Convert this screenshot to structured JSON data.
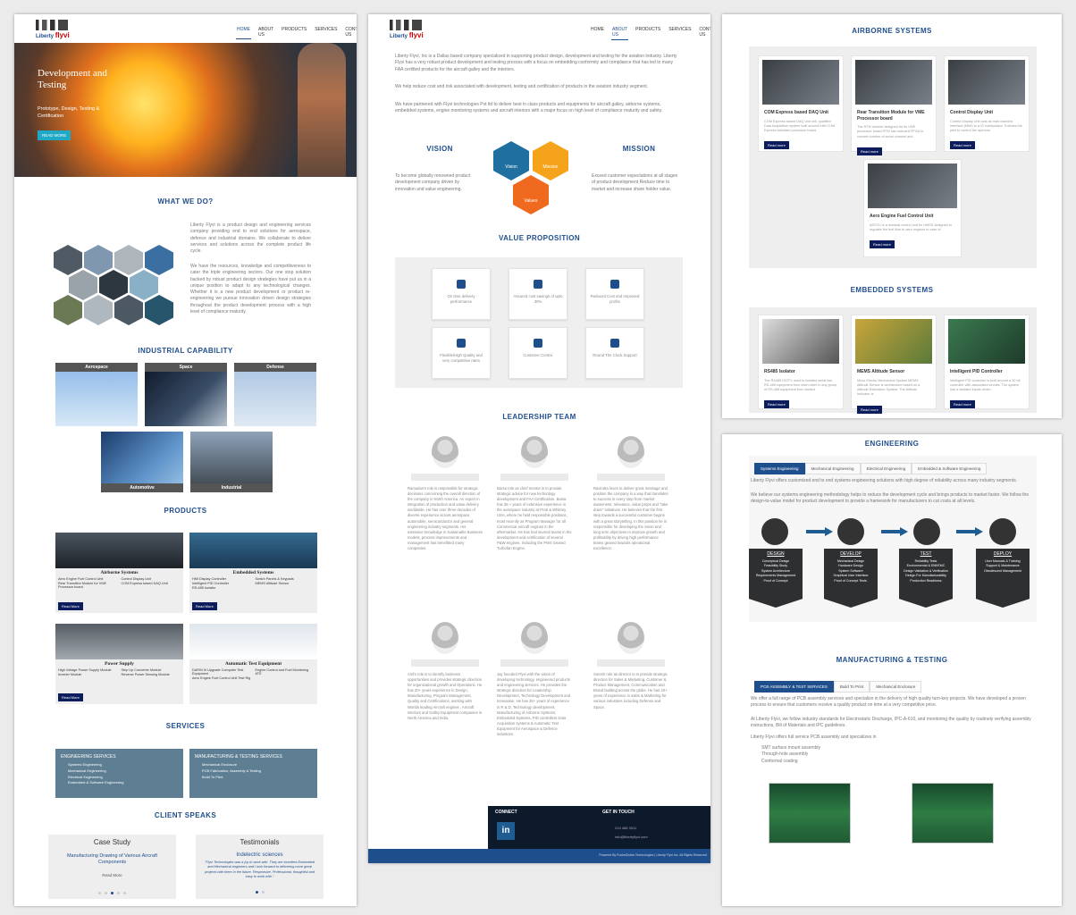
{
  "nav": {
    "home": "HOME",
    "about": "ABOUT US",
    "products": "PRODUCTS",
    "services": "SERVICES",
    "contact": "CONTACT US"
  },
  "logo": {
    "a": "Liberty",
    "b": "flyvi"
  },
  "p1": {
    "hero_title": "Development and Testing",
    "hero_sub": "Prototype, Design, Testing & Certification",
    "hero_btn": "READ MORE",
    "what_title": "WHAT WE DO?",
    "what_p1": "Liberty Flyvi is a product design and engineering services company providing end to end solutions for aerospace, defence and industrial domains. We collaborate to deliver services and solutions across the complete product life cycle.",
    "what_p2": "We have the resources, knowledge and competitiveness to cater the triple engineering sectors. Our one stop solution backed by robust product design strategies have put us in a unique position to adapt to any technological changes. Whether it is a new product development or product re-engineering we pursue innovation driven design strategies throughout the product development process with a high level of compliance maturity.",
    "ind_title": "INDUSTRIAL CAPABILITY",
    "ind": [
      "Aerospace",
      "Space",
      "Defense",
      "Automotive",
      "Industrial"
    ],
    "prod_title": "PRODUCTS",
    "prod_air": "Airborne Systems",
    "prod_air_items": [
      "Aero Engine Fuel Control Unit",
      "Control Display Unit",
      "Rear Transition Module for VME Processor board",
      "COM Express based DAQ Unit"
    ],
    "prod_emb": "Embedded Systems",
    "prod_emb_items": [
      "HMI Display Controller",
      "Switch Panels & Keypads",
      "Intelligent PID Controller",
      "MEMS Altitude Sensor",
      "RS-485 Isolator"
    ],
    "prod_pow": "Power Supply",
    "prod_pow_items": [
      "High Voltage Power Supply Module",
      "Step Up Converter Module",
      "Inverter Module",
      "Reverse Power Sensing Module"
    ],
    "prod_ate": "Automatic Test Equipment",
    "prod_ate_items": [
      "DARIN III Upgrade Computer Test Equipment",
      "Engine Control and Fuel Monitoring ATE",
      "Aero Engine Fuel Control Unit Test Rig"
    ],
    "read_more": "Read More",
    "svc_title": "SERVICES",
    "svc_eng": "ENGINEERING SERVICES",
    "svc_eng_items": [
      "Systems Engineering",
      "Mechanical Engineering",
      "Electrical Engineering",
      "Embedded & Software Engineering"
    ],
    "svc_mfg": "MANUFACTURING & TESTING SERVICES",
    "svc_mfg_items": [
      "Mechanical Enclosure",
      "PCB Fabrication, Assembly & Testing",
      "Build To Print"
    ],
    "client_title": "CLIENT SPEAKS",
    "case_title": "Case Study",
    "case_sub": "Manufacturing Drawing of Various Aircraft Components",
    "case_btn": "Read More",
    "test_title": "Testimonials",
    "test_sub": "Indelectric sciences",
    "test_quote": "\"Flyvi Technologies was a joy to work with. They are excellent Embedded and Mechanical engineers and I look forward to delivering more great projects with them in the future. Responsive, Professional, thoughtful and easy to work with.\""
  },
  "p2": {
    "intro1": "Liberty Flyvi, Inc is a Dallas based company specialized in supporting product design, development and testing for the aviation industry. Liberty Flyvi has a very robust product development and testing process with a focus on embedding conformity and compliance that has led to many FAA certified products for the aircraft galley and the interiors.",
    "intro2": "We help reduce cost and risk associated with development, testing and certification of products in the aviation industry segment.",
    "intro3": "We have partnered with Flyvi technologies Pvt ltd to deliver best in class products and equipments for aircraft galley, airborne systems, embedded systems, engine monitoring systems and aircraft interiors with a major focus on high level of compliance maturity and safety.",
    "vision": "VISION",
    "vision_txt": "To become globally renowned product development company driven by innovation and value engineering.",
    "mission": "MISSION",
    "mission_txt": "Exceed customer expectations at all stages of product development Reduce time to market and increase share holder value.",
    "hex": [
      "Vision",
      "Mission",
      "Values"
    ],
    "vp_title": "VALUE PROPOSITION",
    "vp": [
      "On time delivery performance",
      "Assured cost savings of upto 30%",
      "Reduced Cost and Improved profits",
      "Flexible/High Quality and very competitive rates",
      "Customer Centric",
      "Round The Clock Support"
    ],
    "lead_title": "LEADERSHIP TEAM",
    "leaders": [
      "Ramadas's role is responsible for strategic decisions concerning the overall direction of the company in North America.  An expert in integration of production and value delivery worldwide. He has over three decades of diverse experience across aerospace, automobile, semiconductor and general engineering industry segments. His extensive knowledge in sustainable Business models, process improvements and management has benefitted many companies.",
      "Barsa role as chief mentor is to provide strategic advice for new technology development and FAA Certification.  Barsa has 35 + years of extensive experience in the aerospace industry at Pratt & Whitney USA, where he held responsible positions, most recently as Program Manager for all Commercial aircraft engines in the aftermarket. He has had several teams in the development and certification of several P&W engines, including the PW4 Geared Turbofan Engine.",
      "Ravindra loves to deliver great message and position the company in a way that translates to success in every step from market awareness, relevance, value props and \"take down\" initiatives. He believes that the first step towards a successful customer begins with a great storytelling.  In this position he is responsible for developing the vision and long term objectives to improve growth and profitability by driving high performance teams geared towards operational excellence.",
      "Anil's role is to identify business opportunities and provides strategic direction for organizational growth and Operations.  He has 20+ years experience in Design, Manufacturing, Program Management, Quality and Certifications, working with Worlds leading Aircraft engines , Aircraft interiors and Galley Equipment companies in North America and India.",
      "Jay founded Flyvi with the vision of developing technology, engineered products and engineering services. He provides the strategic direction for Leadership Development, Technology Development and Innovation.  He has 25+ years of experience in R & D, Technology development, Manufacturing of Airborne Systems, Embedded Systems, PID controllers Data Acquisition systems & Automatic Test Equipment for Aerospace & Defence industries.",
      "Suresh role as director is to provide strategic direction for Sales & Marketing, Customer & Product Management, Communication and Brand building across the globe.  He has 20+ years of experience in sales & Marketing for various industries including Defense and Space."
    ],
    "connect": "CONNECT",
    "touch": "GET IN TOUCH",
    "phone": "214 466 3311",
    "email": "info@libertyflyvi.com",
    "footer": "Powered By PocketDollar Technologies | Liberty Flyvi Inc. All Rights Reserved"
  },
  "p3": {
    "air_title": "AIRBORNE SYSTEMS",
    "air": [
      {
        "t": "COM Express based DAQ Unit",
        "d": "COM Express based DAQ Unit will, qualified Data Acquisition system built around Intel COM Express standard processor board"
      },
      {
        "t": "Rear Transition Module for VME Processor board",
        "d": "The RTM module designed for its VME processor board RTM has onboard FPGA to convert number of serial channel and"
      },
      {
        "t": "Control Display Unit",
        "d": "Control Display Unit acts as man machine interface (MMI) to a IO manipulator. It allows the pilot to control the aperture"
      },
      {
        "t": "Aero Engine Fuel Control Unit",
        "d": "AEFCU is a residual control unit for HMSS designed to regulate the fuel flow to aero engines in case of"
      }
    ],
    "emb_title": "EMBEDDED SYSTEMS",
    "emb": [
      {
        "t": "RS485 Isolator",
        "d": "The RS485 ISOTX used to isolates serial two RS-485 equipment from each other in any group of RS-485 equipment from faulted"
      },
      {
        "t": "MEMS Altitude Sensor",
        "d": "Micro Electro Mechanical System MEMS Altitude Sensor is architecture based on a Altitude Estimation System. The Altitude Indicator is"
      },
      {
        "t": "Intelligent PID Controller",
        "d": "Intelligent PID controller is built around a 32 bit controller with associated circuits. The system has a detailed inputs which"
      }
    ],
    "read_more": "Read more"
  },
  "p4": {
    "eng_title": "ENGINEERING",
    "tabs": [
      "Systems Engineering",
      "Mechanical Engineering",
      "Electrical Engineering",
      "Embedded & Software Engineering"
    ],
    "eng_p1": "Liberty Flyvi offers customized end to end systems engineering solutions with high degree of reliability across many industry segments.",
    "eng_p2": "We believe our systems engineering methodology helps to reduce the development cycle and brings products to market faster. We follow the design-to-value model for product development to provide a framework for manufacturers to cut costs at all levels.",
    "steps": [
      {
        "t": "DESIGN",
        "items": [
          "Conceptual Design",
          "Feasibility Study",
          "System Architecture",
          "Requirements Management",
          "Proof of Concept"
        ]
      },
      {
        "t": "DEVELOP",
        "items": [
          "Mechanical Design",
          "Hardware Design",
          "System Software",
          "Graphical User Interface",
          "Proof of Concept Tests."
        ]
      },
      {
        "t": "TEST",
        "items": [
          "Reliability Tests",
          "Environmental & EMI/EMC",
          "Design Validation & Verification",
          "Design For Manufacturability",
          "Production Readiness"
        ]
      },
      {
        "t": "DEPLOY",
        "items": [
          "User Manuals & Training",
          "Support & Maintenance",
          "Obsolescent Management"
        ]
      }
    ],
    "mfg_title": "MANUFACTURING & TESTING",
    "mfg_tabs": [
      "PCB ASSEMBLY & TEST SERVICES",
      "Build To Print",
      "Mechanical Enclosure"
    ],
    "mfg_p1": "We offer a full range of PCB assembly services and specialize in the delivery of high quality turn-key projects. We have developed a proven process to ensure that customers receive a quality product on time at a very competitive price.",
    "mfg_p2": "At Liberty Flyvi, we follow industry standards for Electrostatic Discharge, IPC-A-610, and monitoring the quality by routinely verifying assembly instructions, Bill of Materials and IPC guidelines.",
    "mfg_p3": "Liberty Flyvi offers full service PCB assembly and specializes in",
    "mfg_list": [
      "SMT surface mount assembly",
      "Through-hole assembly",
      "Conformal coating"
    ]
  }
}
